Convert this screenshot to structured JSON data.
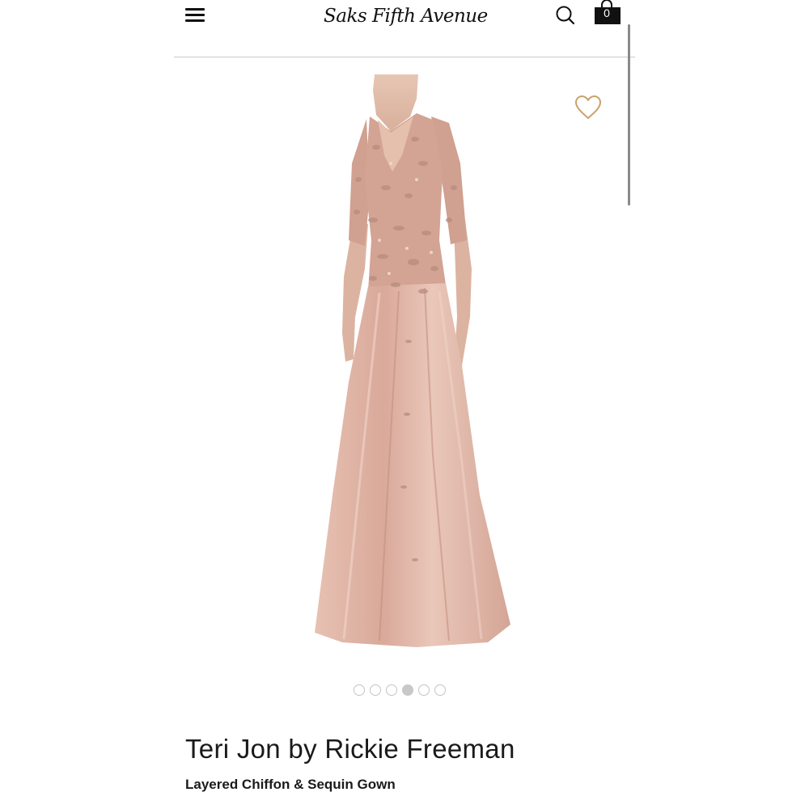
{
  "header": {
    "logo_text": "Saks Fifth Avenue",
    "bag_count": "0"
  },
  "icons": {
    "menu": "hamburger-menu-icon",
    "search": "search-icon",
    "bag": "shopping-bag-icon",
    "wishlist": "heart-outline-icon"
  },
  "carousel": {
    "total": 6,
    "active_index": 3
  },
  "product": {
    "brand": "Teri Jon by Rickie Freeman",
    "name": "Layered Chiffon & Sequin Gown"
  },
  "colors": {
    "wishlist_heart": "#c9a16a",
    "gown_base": "#dfb5a4",
    "gown_sequin": "#b98b7e"
  }
}
